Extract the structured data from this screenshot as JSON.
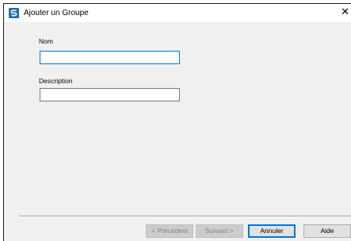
{
  "window": {
    "title": "Ajouter un Groupe",
    "close_glyph": "✕"
  },
  "form": {
    "name_label": "Nom",
    "name_value": "",
    "description_label": "Description",
    "description_value": ""
  },
  "buttons": {
    "previous": "< Précédent",
    "next": "Suivant >",
    "cancel": "Annuler",
    "help": "Aide"
  },
  "colors": {
    "accent": "#0078d7",
    "app_icon": "#1d6fb8"
  },
  "icons": {
    "app": "app-logo-icon",
    "close": "close-icon"
  }
}
